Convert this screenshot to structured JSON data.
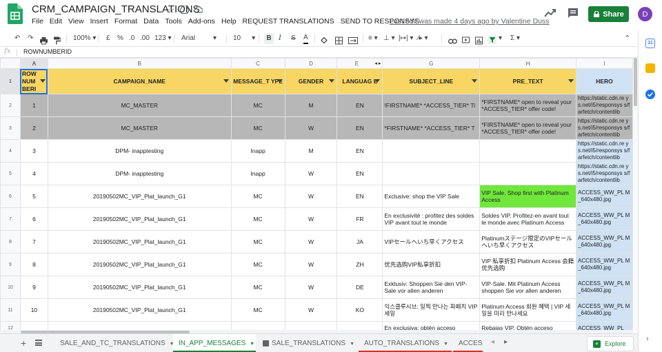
{
  "doc": {
    "title": "CRM_CAMPAIGN_TRANSLATIONS",
    "last_edit": "Last edit was made 4 days ago by Valentine Duss"
  },
  "menu": [
    "File",
    "Edit",
    "View",
    "Insert",
    "Format",
    "Data",
    "Tools",
    "Add-ons",
    "Help",
    "REQUEST TRANSLATIONS",
    "SEND TO RESPONSYS"
  ],
  "share_label": "Share",
  "avatar_letter": "D",
  "toolbar": {
    "zoom": "100%",
    "currency": "£",
    "percent": "%",
    "decimal_dec": ".0",
    "decimal_inc": ".00",
    "more_formats": "123",
    "font": "Arial",
    "font_size": "10",
    "bold": "B",
    "italic": "I",
    "strike": "S",
    "text_color": "A",
    "sum": "Σ"
  },
  "formula_bar": {
    "fx": "fx",
    "value": "ROWNUMBERID"
  },
  "columns": {
    "letters": [
      "A",
      "B",
      "C",
      "D",
      "E",
      "G",
      "H",
      "I"
    ],
    "headers": [
      "ROW NUM BERI",
      "CAMPAIGN_NAME",
      "MESSAGE_T YPE",
      "GENDER",
      "LANGUAG E",
      "SUBJECT_LINE",
      "PRE_TEXT",
      "HERO"
    ]
  },
  "rows": [
    {
      "num": "2",
      "cells": [
        "1",
        "MC_MASTER",
        "MC",
        "M",
        "EN",
        "!FIRSTNAME* *ACCESS_TIER* Ti",
        "*FIRSTNAME* open to reveal your *ACCESS_TIER* offer code!",
        "https://static.cdn.re ys.net/i5/responsys s/farfetch/contentlib"
      ],
      "gray": true
    },
    {
      "num": "3",
      "cells": [
        "2",
        "MC_MASTER",
        "MC",
        "W",
        "EN",
        "*FIRSTNAME* *ACCESS_TIER* T",
        "*FIRSTNAME* open to reveal your *ACCESS_TIER* offer code!",
        "https://static.cdn.re ys.net/i5/responsys s/farfetch/contentlib"
      ],
      "gray": true
    },
    {
      "num": "4",
      "cells": [
        "3",
        "DPM- inapptesting",
        "Inapp",
        "M",
        "EN",
        "",
        "",
        "https://static.cdn.re ys.net/i5/responsys s/farfetch/contentlib"
      ],
      "gray": false
    },
    {
      "num": "5",
      "cells": [
        "4",
        "DPM- inapptesting",
        "Inapp",
        "W",
        "EN",
        "",
        "",
        "https://static.cdn.re ys.net/i5/responsys s/farfetch/contentlib"
      ],
      "gray": false
    },
    {
      "num": "6",
      "cells": [
        "5",
        "20190502MC_VIP_Plat_launch_G1",
        "MC",
        "W",
        "EN",
        "Exclusive: shop the VIP Sale",
        "VIP Sale. Shop first with Platinum Access",
        "ACCESS_WW_PL M_640x480.jpg"
      ],
      "gray": false,
      "green_pre": true
    },
    {
      "num": "7",
      "cells": [
        "6",
        "20190502MC_VIP_Plat_launch_G1",
        "MC",
        "W",
        "FR",
        "En exclusivité : profitez des soldes VIP avant tout le monde",
        "Soldes VIP. Profitez-en avant tout le monde avec Platinum Access",
        "ACCESS_WW_PL M_640x480.jpg"
      ],
      "gray": false
    },
    {
      "num": "8",
      "cells": [
        "7",
        "20190502MC_VIP_Plat_launch_G1",
        "MC",
        "W",
        "JA",
        "VIPセールへいち早くアクセス",
        "Platinumステージ限定のVIPセールへいち早くアクセス",
        "ACCESS_WW_PL M_640x480.jpg"
      ],
      "gray": false
    },
    {
      "num": "9",
      "cells": [
        "8",
        "20190502MC_VIP_Plat_launch_G1",
        "MC",
        "W",
        "ZH",
        "优先选购VIP私享折扣",
        "VIP 私享折扣 Platinum Access 会籍优先选购",
        "ACCESS_WW_PL M_640x480.jpg"
      ],
      "gray": false
    },
    {
      "num": "10",
      "cells": [
        "9",
        "20190502MC_VIP_Plat_launch_G1",
        "MC",
        "W",
        "DE",
        "Exklusiv: Shoppen Sie den VIP-Sale vor allen anderen",
        "VIP-Sale. Mit Platinum Access shoppen Sie vor allen anderen",
        "ACCESS_WW_PL M_640x480.jpg"
      ],
      "gray": false
    },
    {
      "num": "11",
      "cells": [
        "10",
        "20190502MC_VIP_Plat_launch_G1",
        "MC",
        "W",
        "KO",
        "익스클루시브: 일찍 만나는 파페치 VIP 세일",
        "Platinum Access 회원 혜택 | VIP 세일을 미리 만나세요",
        "ACCESS_WW_PL M_640x480.jpg"
      ],
      "gray": false
    },
    {
      "num": "12",
      "cells": [
        "",
        "",
        "",
        "",
        "",
        "En exclusiva: obtén acceso",
        "Rebajas VIP. Obtén acceso",
        "ACCESS_WW_PL"
      ],
      "gray": false
    }
  ],
  "sheets": [
    {
      "label": "SALE_AND_TC_TRANSLATIONS",
      "active": false
    },
    {
      "label": "IN_APP_MESSAGES",
      "active": true
    },
    {
      "label": "SALE_TRANSLATIONS",
      "active": false
    },
    {
      "label": "AUTO_TRANSLATIONS",
      "active": false
    },
    {
      "label": "ACCES",
      "active": false
    }
  ],
  "explore_label": "Explore"
}
